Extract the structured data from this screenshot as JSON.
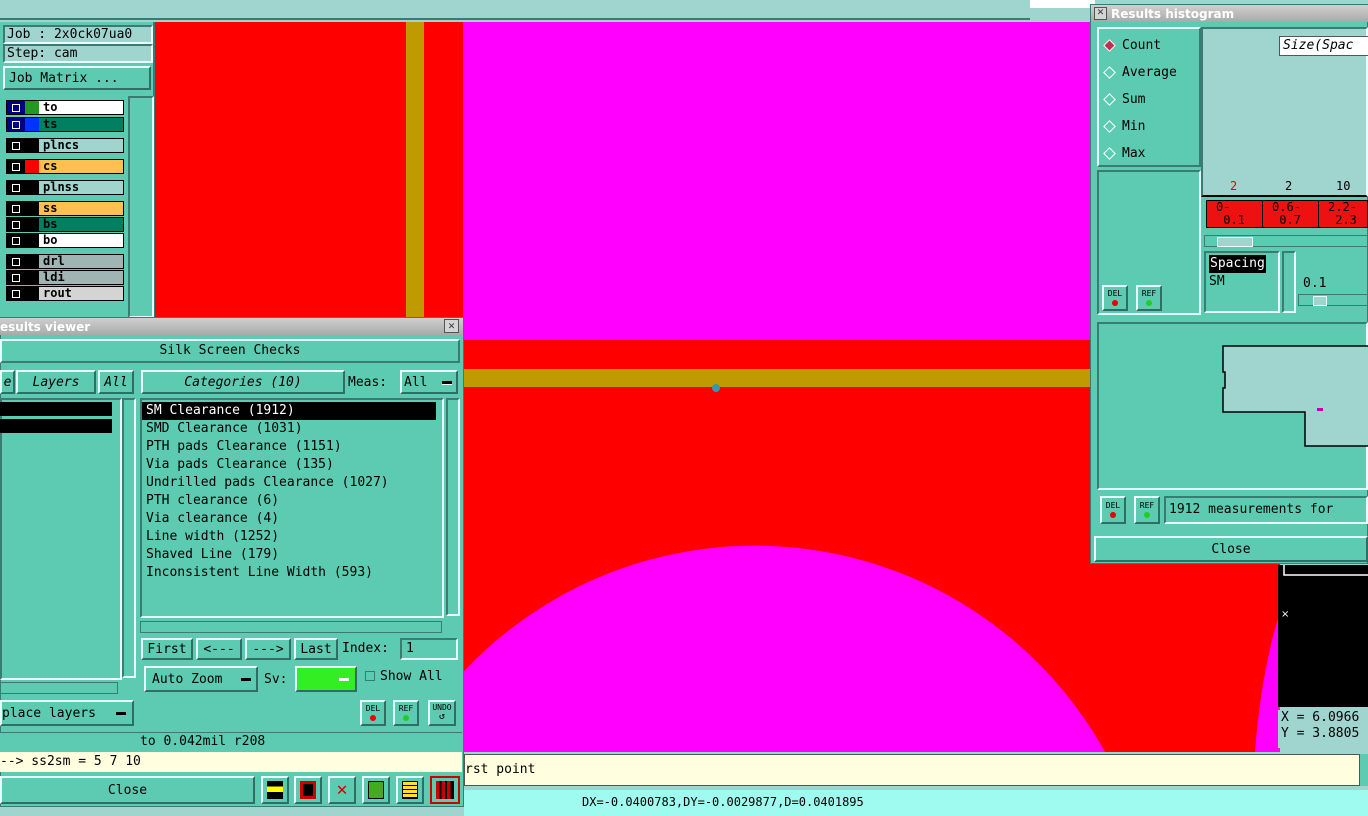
{
  "colors": {
    "canvas_red": "#ff0000",
    "canvas_magenta": "#ff00ff",
    "trace": "#bf9a00",
    "panel": "#5ccbb1",
    "light": "#9fd4cf",
    "yellow_status": "#ffffe0"
  },
  "job": {
    "job_line": "Job : 2x0ck07ua0",
    "step_line": "Step: cam",
    "matrix_label": "Job Matrix ..."
  },
  "layers": [
    {
      "name": "to",
      "c1": "#000080",
      "c2": "#229922",
      "bg": "#ffffff"
    },
    {
      "name": "ts",
      "c1": "#000080",
      "c2": "#0033ff",
      "bg": "#008060"
    },
    {
      "name": "plncs",
      "c1": "#000000",
      "c2": "#000000",
      "bg": "#9fd4cf"
    },
    {
      "name": "cs",
      "c1": "#000000",
      "c2": "#ff0000",
      "bg": "#ffc050"
    },
    {
      "name": "plnss",
      "c1": "#000000",
      "c2": "#000000",
      "bg": "#9fd4cf"
    },
    {
      "name": "ss",
      "c1": "#000000",
      "c2": "#000000",
      "bg": "#ffc050"
    },
    {
      "name": "bs",
      "c1": "#000000",
      "c2": "#000000",
      "bg": "#008060"
    },
    {
      "name": "bo",
      "c1": "#000000",
      "c2": "#000000",
      "bg": "#ffffff"
    },
    {
      "name": "drl",
      "c1": "#000000",
      "c2": "#000000",
      "bg": "#a0b4b4"
    },
    {
      "name": "ldi",
      "c1": "#000000",
      "c2": "#000000",
      "bg": "#a0b4b4"
    },
    {
      "name": "rout",
      "c1": "#000000",
      "c2": "#000000",
      "bg": "#d4d4d4"
    }
  ],
  "results_viewer": {
    "title": "esults viewer",
    "header": "Silk Screen Checks",
    "left_tab_partial": "e",
    "layers_tab": "Layers",
    "all_tab": "All",
    "categories_label": "Categories (10)",
    "meas_label": "Meas:",
    "meas_value": "All",
    "categories": [
      "SM Clearance (1912)",
      "SMD Clearance (1031)",
      "PTH pads Clearance (1151)",
      "Via pads Clearance (135)",
      "Undrilled pads Clearance (1027)",
      "PTH clearance (6)",
      "Via clearance (4)",
      "Line width (1252)",
      "Shaved Line (179)",
      "Inconsistent Line Width (593)"
    ],
    "first": "First",
    "prev": "<---",
    "next": "--->",
    "last": "Last",
    "index_label": "Index:",
    "index_value": "1",
    "auto_zoom": "Auto Zoom",
    "sv_label": "Sv:",
    "show_all": "Show All",
    "place_layers": "place layers",
    "del": "DEL",
    "ref": "REF",
    "undo": "UNDO",
    "range_text": "to 0.042mil  r208",
    "command_text": "--> ss2sm = 5 7 10",
    "close": "Close"
  },
  "histogram": {
    "title": "Results histogram",
    "modes": [
      "Count",
      "Average",
      "Sum",
      "Min",
      "Max"
    ],
    "selected_mode": "Count",
    "size_label": "Size(Spac",
    "counts": [
      "2",
      "2",
      "10"
    ],
    "bins": [
      "0-\n 0.1",
      "0.6-\n 0.7",
      "2.2-\n 2.3"
    ],
    "list_items": [
      "Spacing",
      "SM"
    ],
    "value": "0.1",
    "del": "DEL",
    "ref": "REF",
    "summary": "1912 measurements for ",
    "close": "Close"
  },
  "status": {
    "prompt": "rst point",
    "delta": "DX=-0.0400783,DY=-0.0029877,D=0.0401895",
    "x": "X = 6.0966",
    "y": "Y = 3.8805"
  }
}
